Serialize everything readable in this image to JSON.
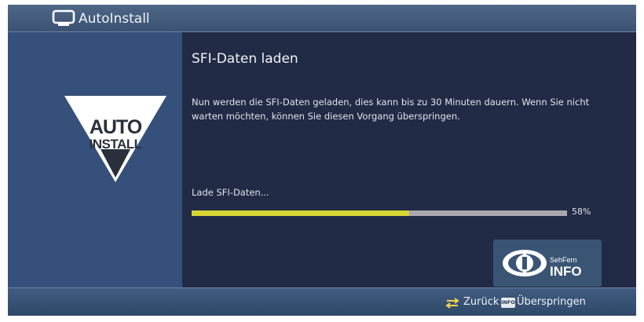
{
  "window": {
    "title": "AutoInstall",
    "icon": "tv-icon"
  },
  "sidebar": {
    "logo": {
      "icon": "auto-install-logo",
      "line1": "AUTO",
      "line2": "INSTALL"
    }
  },
  "main": {
    "heading": "SFI-Daten laden",
    "description": "Nun werden die SFI-Daten geladen, dies kann bis zu 30 Minuten dauern. Wenn Sie nicht warten möchten, können Sie diesen Vorgang überspringen.",
    "loading_label": "Lade SFI-Daten...",
    "progress": {
      "value": 0.58,
      "label": "58%",
      "fill_color": "#d7d433",
      "track_color": "#a9a9ad"
    },
    "info_badge": {
      "icon": "sehfern-info-logo",
      "line1": "SehFern",
      "line2": "INFO"
    }
  },
  "footer": {
    "back_icon": "return-arrows-icon",
    "back_label": "Zurück",
    "info_key": "INFO",
    "skip_label": "Überspringen"
  },
  "colors": {
    "background": "#1e2740",
    "sidebar": "#35507a",
    "titlebar": "#4a6283",
    "text": "#eef2f8"
  }
}
